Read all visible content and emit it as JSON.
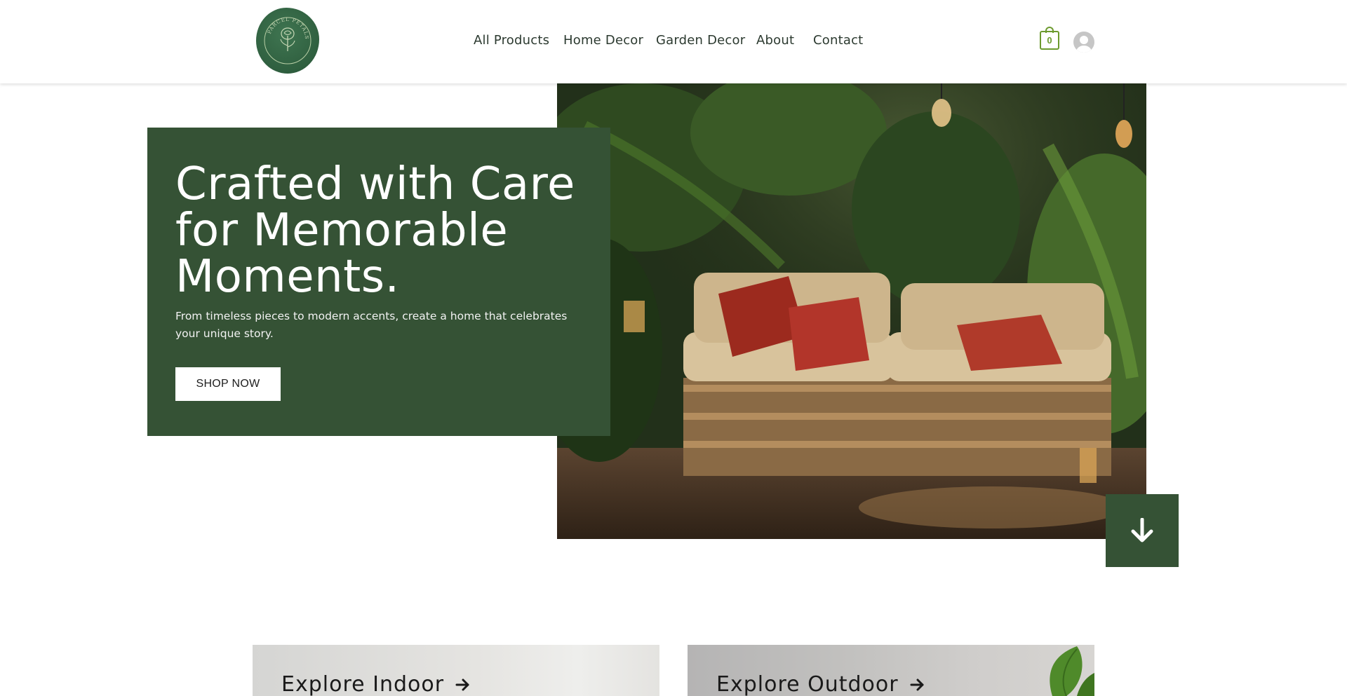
{
  "header": {
    "logo_text": "PARCEL PETALS",
    "nav": [
      {
        "label": "All Products"
      },
      {
        "label": "Home Decor"
      },
      {
        "label": "Garden Decor"
      },
      {
        "label": "About"
      },
      {
        "label": "Contact"
      }
    ],
    "cart_count": "0"
  },
  "hero": {
    "title": "Crafted with Care for Memorable Moments.",
    "subtitle": "From timeless pieces to modern accents, create a home that celebrates your unique story.",
    "cta_label": "SHOP NOW"
  },
  "explore": [
    {
      "label": "Explore Indoor"
    },
    {
      "label": "Explore Outdoor"
    }
  ],
  "colors": {
    "brand_green": "#355235",
    "cart_accent": "#6c9a2e",
    "text_dark": "#2c3a30"
  },
  "icons": [
    "logo-seal-icon",
    "cart-icon",
    "avatar-icon",
    "arrow-down-icon",
    "arrow-right-icon"
  ]
}
